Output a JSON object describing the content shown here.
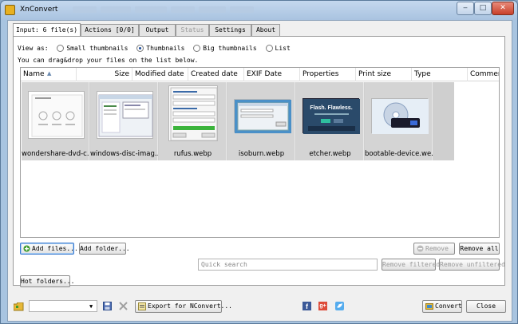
{
  "window": {
    "title": "XnConvert",
    "min_label": "‒",
    "max_label": "□",
    "close_label": "✕"
  },
  "tabs": [
    {
      "label": "Input: 6 file(s)",
      "state": "active"
    },
    {
      "label": "Actions [0/0]",
      "state": "normal"
    },
    {
      "label": "Output",
      "state": "normal"
    },
    {
      "label": "Status",
      "state": "disabled"
    },
    {
      "label": "Settings",
      "state": "normal"
    },
    {
      "label": "About",
      "state": "normal"
    }
  ],
  "view": {
    "label": "View as:",
    "options": [
      {
        "label": "Small thumbnails",
        "checked": false
      },
      {
        "label": "Thumbnails",
        "checked": true
      },
      {
        "label": "Big thumbnails",
        "checked": false
      },
      {
        "label": "List",
        "checked": false
      }
    ],
    "hint": "You can drag&drop your files on the list below."
  },
  "list": {
    "columns": [
      "Name",
      "Size",
      "Modified date",
      "Created date",
      "EXIF Date",
      "Properties",
      "Print size",
      "Type",
      "Commen"
    ],
    "files": [
      {
        "name": "wondershare-dvd-c..."
      },
      {
        "name": "windows-disc-imag..."
      },
      {
        "name": "rufus.webp"
      },
      {
        "name": "isoburn.webp"
      },
      {
        "name": "etcher.webp"
      },
      {
        "name": "bootable-device.we..."
      }
    ],
    "etcher_caption": "Flash. Flawless."
  },
  "buttons": {
    "add_files": "Add files...",
    "add_folder": "Add folder...",
    "remove": "Remove",
    "remove_all": "Remove all",
    "remove_filtered": "Remove filtered",
    "remove_unfiltered": "Remove unfiltered",
    "hot_folders": "Hot folders...",
    "export": "Export for NConvert...",
    "convert": "Convert",
    "close": "Close"
  },
  "search": {
    "placeholder": "Quick search",
    "value": ""
  },
  "preset": {
    "value": ""
  },
  "colors": {
    "accent": "#3a7ad0",
    "titlebar": "#a9c3e0",
    "facebook": "#3b5998",
    "google": "#dd4b39",
    "twitter": "#55acee"
  }
}
